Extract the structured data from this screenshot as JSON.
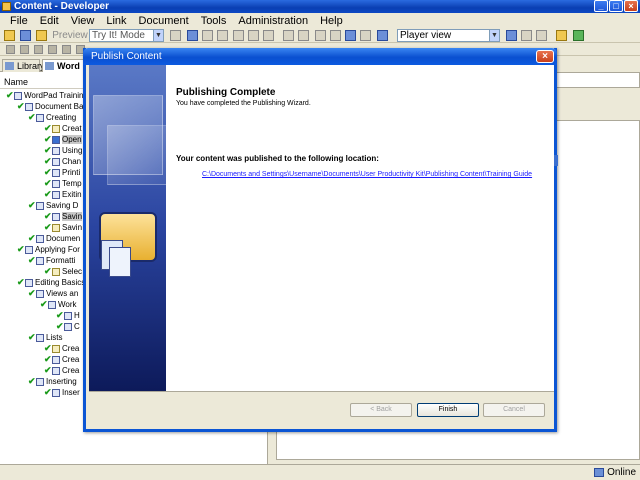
{
  "window": {
    "title": "Content - Developer"
  },
  "menu": [
    "File",
    "Edit",
    "View",
    "Link",
    "Document",
    "Tools",
    "Administration",
    "Help"
  ],
  "toolbar": {
    "preview_label": "Preview",
    "mode_value": "Try It! Mode",
    "view_value": "Player view"
  },
  "left_panel": {
    "tabs": [
      {
        "label": "Library"
      },
      {
        "label": "Word"
      }
    ],
    "column_header": "Name",
    "tree": [
      {
        "label": "WordPad Training"
      },
      {
        "label": "Document Ba"
      },
      {
        "label": "Creating"
      },
      {
        "label": "Creat"
      },
      {
        "label": "Open"
      },
      {
        "label": "Using"
      },
      {
        "label": "Chan"
      },
      {
        "label": "Printi"
      },
      {
        "label": "Temp"
      },
      {
        "label": "Exitin"
      },
      {
        "label": "Saving D"
      },
      {
        "label": "Savin"
      },
      {
        "label": "Savin"
      },
      {
        "label": "Documen"
      },
      {
        "label": "Applying For"
      },
      {
        "label": "Formatti"
      },
      {
        "label": "Selec"
      },
      {
        "label": "Editing Basics"
      },
      {
        "label": "Views an"
      },
      {
        "label": "Work"
      },
      {
        "label": "H"
      },
      {
        "label": "C"
      },
      {
        "label": "Lists"
      },
      {
        "label": "Crea"
      },
      {
        "label": "Crea"
      },
      {
        "label": "Crea"
      },
      {
        "label": "Inserting"
      },
      {
        "label": "Inser"
      }
    ]
  },
  "dialog": {
    "title": "Publish Content",
    "heading": "Publishing Complete",
    "subtitle": "You have completed the Publishing Wizard.",
    "location_label": "Your content was published to the following location:",
    "location_link": "C:\\Documents and Settings\\Username\\Documents\\User Productivity Kit\\Publishing Content\\Training Guide",
    "buttons": {
      "back": "< Back",
      "finish": "Finish",
      "cancel": "Cancel"
    }
  },
  "status": {
    "online": "Online"
  },
  "colors": {
    "titlebar": "#0a4fd0",
    "link": "#1a1aff",
    "check": "#1a9a1a"
  }
}
